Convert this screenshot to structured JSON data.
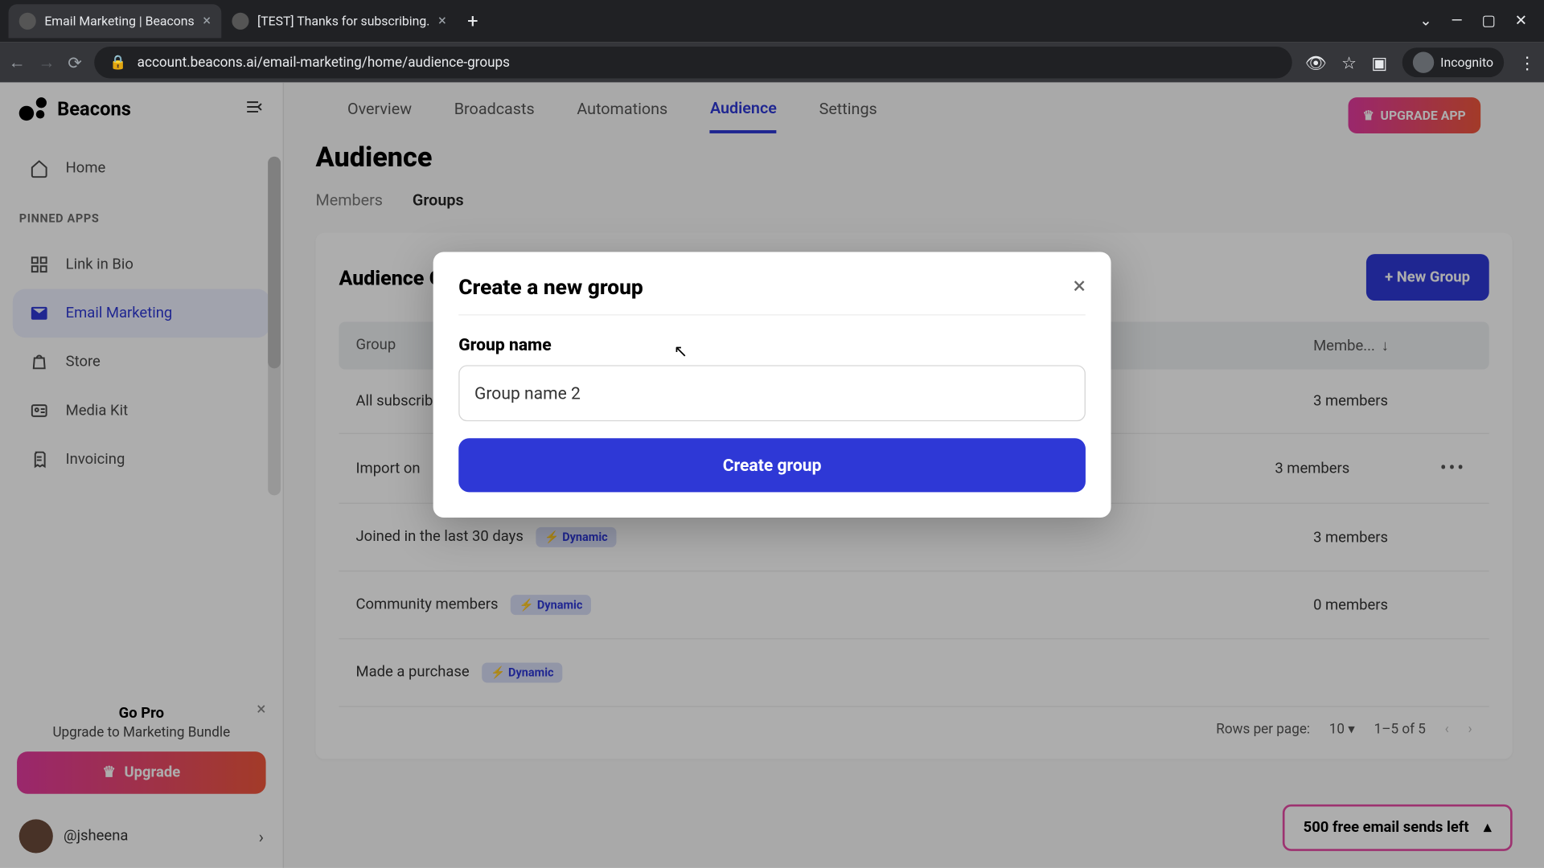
{
  "browser": {
    "tabs": [
      {
        "title": "Email Marketing | Beacons",
        "active": true
      },
      {
        "title": "[TEST] Thanks for subscribing.",
        "active": false
      }
    ],
    "url": "account.beacons.ai/email-marketing/home/audience-groups",
    "mode_label": "Incognito"
  },
  "brand": "Beacons",
  "sidebar": {
    "home": "Home",
    "section_pinned": "PINNED APPS",
    "items": [
      {
        "label": "Link in Bio",
        "icon": "grid-icon"
      },
      {
        "label": "Email Marketing",
        "icon": "envelope-icon",
        "active": true
      },
      {
        "label": "Store",
        "icon": "bag-icon"
      },
      {
        "label": "Media Kit",
        "icon": "user-card-icon"
      },
      {
        "label": "Invoicing",
        "icon": "invoice-icon"
      }
    ],
    "promo": {
      "title": "Go Pro",
      "subtitle": "Upgrade to Marketing Bundle",
      "button": "Upgrade"
    },
    "user": {
      "handle": "@jsheena"
    }
  },
  "top_tabs": [
    "Overview",
    "Broadcasts",
    "Automations",
    "Audience",
    "Settings"
  ],
  "active_top_tab": "Audience",
  "upgrade_app": "UPGRADE APP",
  "page_title": "Audience",
  "sub_tabs": [
    "Members",
    "Groups"
  ],
  "active_sub_tab": "Groups",
  "card": {
    "title": "Audience Groups",
    "new_button": "+ New Group",
    "col_group": "Group",
    "col_members": "Membe...",
    "rows": [
      {
        "name": "All subscribers",
        "members": "3 members",
        "dynamic": false,
        "more": false
      },
      {
        "name": "Import on ",
        "members": "3 members",
        "dynamic": false,
        "more": true
      },
      {
        "name": "Joined in the last 30 days",
        "members": "3 members",
        "dynamic": true,
        "more": false
      },
      {
        "name": "Community members",
        "members": "0 members",
        "dynamic": true,
        "more": false
      },
      {
        "name": "Made a purchase",
        "members": "",
        "dynamic": true,
        "more": false
      }
    ],
    "dynamic_label": "Dynamic",
    "pager": {
      "rows_label": "Rows per page:",
      "rows_value": "10",
      "range": "1–5 of 5"
    }
  },
  "sends_left": "500 free email sends left",
  "modal": {
    "title": "Create a new group",
    "field_label": "Group name",
    "input_value": "Group name 2",
    "submit": "Create group"
  },
  "colors": {
    "primary": "#2e38d6",
    "accent_gradient_from": "#e43aa0",
    "accent_gradient_to": "#f0573c"
  }
}
